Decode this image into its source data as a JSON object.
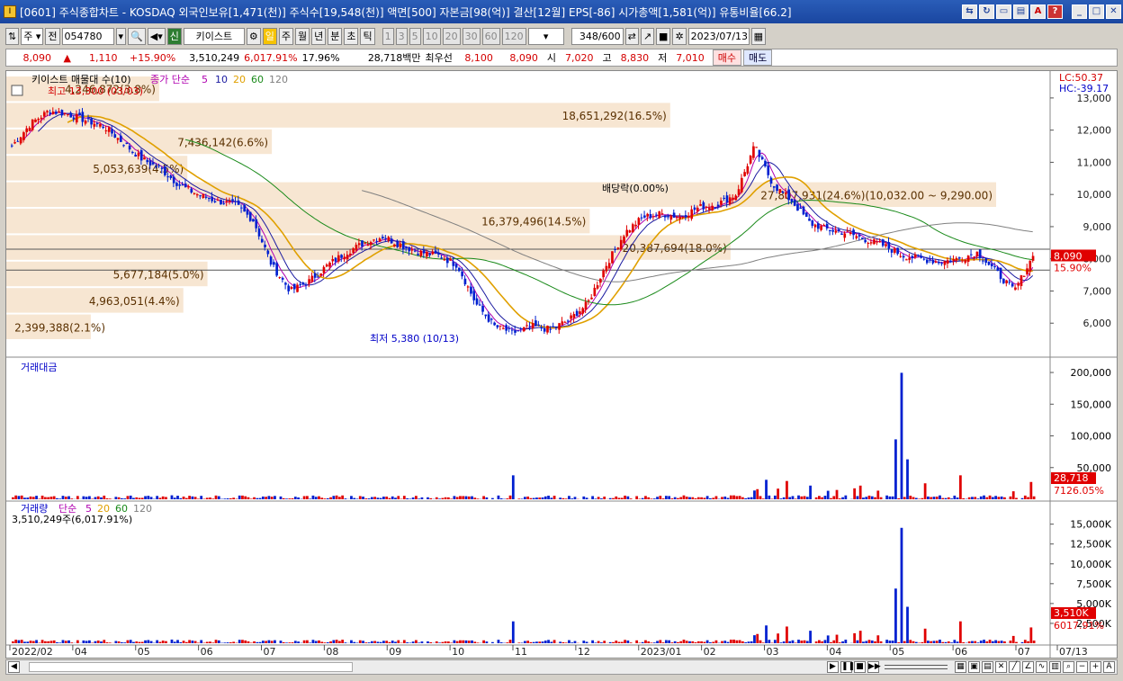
{
  "title": {
    "code": "[0601]",
    "text": "주식종합차트 - KOSDAQ 외국인보유[1,471(천)] 주식수[19,548(천)] 액면[500] 자본금[98(억)] 결산[12월] EPS[-86] 시가총액[1,581(억)] 유통비율[66.2]"
  },
  "toolbar": {
    "type": "주",
    "prefix": "전",
    "code": "054780",
    "new_label": "신",
    "name": "키이스트",
    "periods": [
      "일",
      "주",
      "월",
      "년",
      "분",
      "초",
      "틱"
    ],
    "intervals": [
      "1",
      "3",
      "5",
      "10",
      "20",
      "30",
      "60",
      "120"
    ],
    "count": "348",
    "total": "/600",
    "date": "2023/07/13"
  },
  "quote": {
    "price": "8,090",
    "arrow": "▲",
    "change": "1,110",
    "pct": "+15.90%",
    "volume": "3,510,249",
    "vol_pct": "6,017.91%",
    "turnover": "17.96%",
    "amount": "28,718백만",
    "hoga_label": "최우선",
    "ask": "8,100",
    "bid": "8,090",
    "open_l": "시",
    "open": "7,020",
    "high_l": "고",
    "high": "8,830",
    "low_l": "저",
    "low": "7,010",
    "buy": "매수",
    "sell": "매도"
  },
  "price_panel": {
    "legend_name": "키이스트 매물대 수(10)",
    "ma_title": "종가 단순",
    "ma": [
      "5",
      "10",
      "20",
      "60",
      "120"
    ],
    "ma_colors": [
      "#b000b0",
      "#1a1aa0",
      "#e0a000",
      "#1a8a1a",
      "#808080"
    ],
    "lc": "LC:50.37",
    "hc": "HC:-39.17",
    "high_label": "최고 13,300 (03/03)",
    "low_label": "최저 5,380 (10/13)",
    "div_label": "배당락(0.00%)",
    "cur": "8,090",
    "cur_pct": "15.90%",
    "yticks": [
      "13,000",
      "12,000",
      "11,000",
      "10,000",
      "9,000",
      "8,000",
      "7,000",
      "6,000"
    ]
  },
  "vol_profile": [
    "2,399,388(2.1%)",
    "4,963,051(4.4%)",
    "5,677,184(5.0%)",
    "20,387,694(18.0%)",
    "16,379,496(14.5%)",
    "27,807,931(24.6%)(10,032.00 ~ 9,290.00)",
    "5,053,639(4.5%)",
    "7,436,142(6.6%)",
    "18,651,292(16.5%)",
    "4,246,872(3.8%)"
  ],
  "amount_panel": {
    "title": "거래대금",
    "yticks": [
      "200,000",
      "150,000",
      "100,000",
      "50,000"
    ],
    "cur": "28,718",
    "cur_pct": "7126.05%"
  },
  "volume_panel": {
    "title": "거래량",
    "ma_title": "단순",
    "ma": [
      "5",
      "20",
      "60",
      "120"
    ],
    "ma_colors": [
      "#b000b0",
      "#e0a000",
      "#1a8a1a",
      "#808080"
    ],
    "subtitle": "3,510,249주(6,017.91%)",
    "yticks": [
      "15,000K",
      "12,500K",
      "10,000K",
      "7,500K",
      "5,000K",
      "2,500K"
    ],
    "cur": "3,510K",
    "cur_pct": "6017.91%"
  },
  "xaxis": [
    "2022/02",
    "04",
    "05",
    "06",
    "07",
    "08",
    "09",
    "10",
    "11",
    "12",
    "2023/01",
    "02",
    "03",
    "04",
    "05",
    "06",
    "07",
    "07/13"
  ],
  "chart_data": {
    "type": "candlestick",
    "x_months": [
      "2022/02",
      "04",
      "05",
      "06",
      "07",
      "08",
      "09",
      "10",
      "11",
      "12",
      "2023/01",
      "02",
      "03",
      "04",
      "05",
      "06",
      "07"
    ],
    "close_path": [
      11500,
      12200,
      12600,
      12500,
      12300,
      12100,
      11600,
      11100,
      10800,
      10300,
      10000,
      9800,
      9700,
      9200,
      7800,
      7000,
      7300,
      7800,
      8200,
      8500,
      8700,
      8400,
      8200,
      8100,
      7800,
      6600,
      5900,
      5700,
      5900,
      5800,
      6100,
      6600,
      7800,
      8800,
      9300,
      9400,
      9300,
      9600,
      9700,
      10000,
      11500,
      10300,
      9800,
      9100,
      8900,
      8800,
      8600,
      8400,
      8100,
      8000,
      7900,
      8000,
      8200,
      7600,
      7000,
      8090
    ],
    "volume_profile_pct": [
      2.1,
      4.4,
      5.0,
      18.0,
      14.5,
      24.6,
      4.5,
      6.6,
      16.5,
      3.8
    ],
    "ylim": [
      5000,
      13500
    ],
    "amount_ylim": [
      0,
      210000
    ],
    "volume_ylim": [
      0,
      17000
    ]
  }
}
